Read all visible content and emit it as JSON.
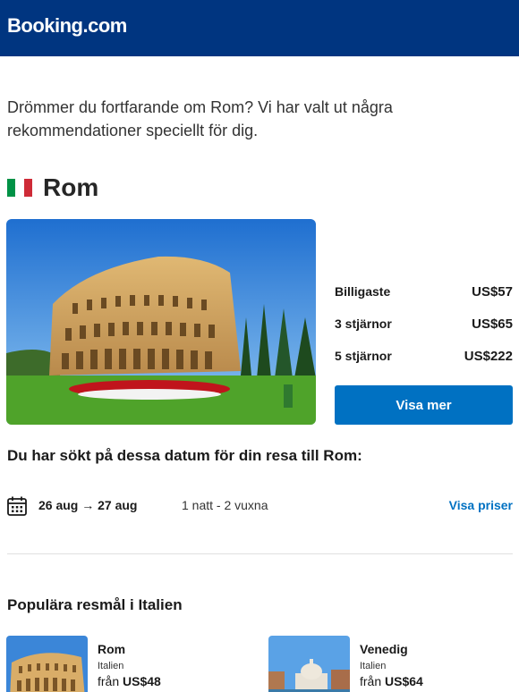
{
  "header": {
    "logo": "Booking.com",
    "brand_color": "#003580"
  },
  "intro": "Drömmer du fortfarande om Rom? Vi har valt ut några rekommendationer speciellt för dig.",
  "destination": {
    "name": "Rom",
    "flag_icon": "italy-flag-icon",
    "prices": [
      {
        "label": "Billigaste",
        "value": "US$57"
      },
      {
        "label": "3 stjärnor",
        "value": "US$65"
      },
      {
        "label": "5 stjärnor",
        "value": "US$222"
      }
    ],
    "more_button": "Visa mer"
  },
  "search": {
    "heading": "Du har sökt på dessa datum för din resa till Rom:",
    "dates": "26 aug → 27 aug",
    "guests": "1 natt - 2 vuxna",
    "link": "Visa priser"
  },
  "popular": {
    "heading": "Populära resmål i Italien",
    "items": [
      {
        "name": "Rom",
        "country": "Italien",
        "from": "från",
        "price": "US$48"
      },
      {
        "name": "Venedig",
        "country": "Italien",
        "from": "från",
        "price": "US$64"
      }
    ]
  },
  "colors": {
    "accent": "#0071c2",
    "header": "#003580"
  }
}
